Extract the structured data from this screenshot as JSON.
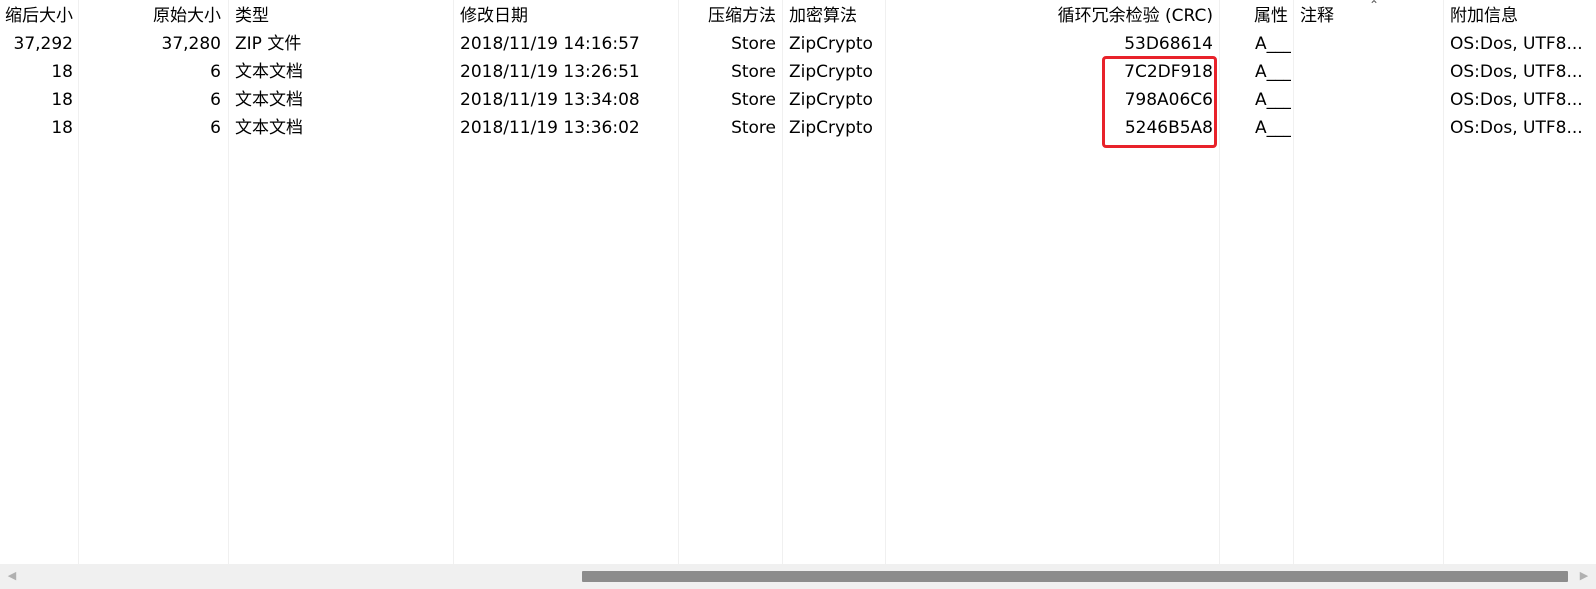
{
  "columns": {
    "compressed_size": "缩后大小",
    "original_size": "原始大小",
    "type": "类型",
    "modified": "修改日期",
    "method": "压缩方法",
    "encryption": "加密算法",
    "crc": "循环冗余检验 (CRC)",
    "attributes": "属性",
    "comment": "注释",
    "extra": "附加信息"
  },
  "rows": [
    {
      "compressed_size": "37,292",
      "original_size": "37,280",
      "type": "ZIP 文件",
      "modified": "2018/11/19 14:16:57",
      "method": "Store",
      "encryption": "ZipCrypto",
      "crc": "53D68614",
      "attributes": "A___",
      "comment": "",
      "extra": "OS:Dos, UTF8..."
    },
    {
      "compressed_size": "18",
      "original_size": "6",
      "type": "文本文档",
      "modified": "2018/11/19 13:26:51",
      "method": "Store",
      "encryption": "ZipCrypto",
      "crc": "7C2DF918",
      "attributes": "A___",
      "comment": "",
      "extra": "OS:Dos, UTF8..."
    },
    {
      "compressed_size": "18",
      "original_size": "6",
      "type": "文本文档",
      "modified": "2018/11/19 13:34:08",
      "method": "Store",
      "encryption": "ZipCrypto",
      "crc": "798A06C6",
      "attributes": "A___",
      "comment": "",
      "extra": "OS:Dos, UTF8..."
    },
    {
      "compressed_size": "18",
      "original_size": "6",
      "type": "文本文档",
      "modified": "2018/11/19 13:36:02",
      "method": "Store",
      "encryption": "ZipCrypto",
      "crc": "5246B5A8",
      "attributes": "A___",
      "comment": "",
      "extra": "OS:Dos, UTF8..."
    }
  ],
  "sort": {
    "column": "comment",
    "direction": "ascending",
    "icon": "chevron-up-icon"
  },
  "highlight": {
    "color": "#e8222a",
    "column": "crc",
    "rows": [
      1,
      2,
      3
    ]
  },
  "scrollbar": {
    "left_icon": "arrow-left-icon",
    "right_icon": "arrow-right-icon"
  }
}
